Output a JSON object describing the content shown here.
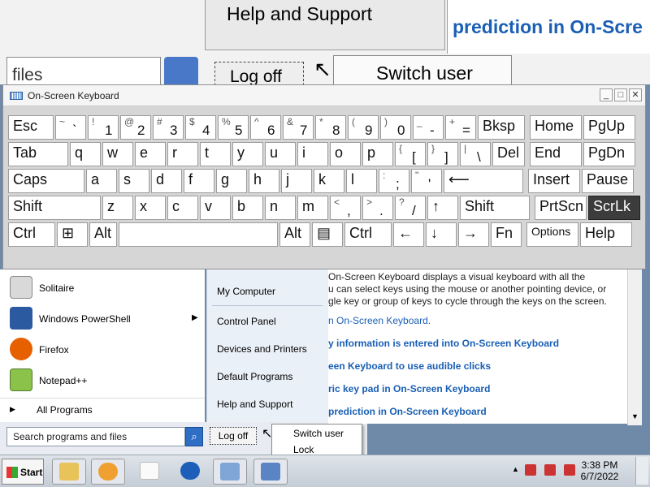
{
  "background": {
    "help_and_support": "Help and Support",
    "prediction_text": "prediction in On-Scre",
    "files_text": "files",
    "log_off": "Log off",
    "switch_user": "Switch user"
  },
  "osk": {
    "title": "On-Screen Keyboard",
    "controls": [
      "_",
      "□",
      "✕"
    ]
  },
  "keyboard": {
    "row1": [
      {
        "m": "Esc"
      },
      {
        "t": "~",
        "b": "`"
      },
      {
        "t": "!",
        "b": "1"
      },
      {
        "t": "@",
        "b": "2"
      },
      {
        "t": "#",
        "b": "3"
      },
      {
        "t": "$",
        "b": "4"
      },
      {
        "t": "%",
        "b": "5"
      },
      {
        "t": "^",
        "b": "6"
      },
      {
        "t": "&",
        "b": "7"
      },
      {
        "t": "*",
        "b": "8"
      },
      {
        "t": "(",
        "b": "9"
      },
      {
        "t": ")",
        "b": "0"
      },
      {
        "t": "_",
        "b": "-"
      },
      {
        "t": "+",
        "b": "="
      },
      {
        "m": "Bksp"
      },
      {
        "m": "Home"
      },
      {
        "m": "PgUp"
      }
    ],
    "row2": [
      {
        "m": "Tab"
      },
      {
        "m": "q"
      },
      {
        "m": "w"
      },
      {
        "m": "e"
      },
      {
        "m": "r"
      },
      {
        "m": "t"
      },
      {
        "m": "y"
      },
      {
        "m": "u"
      },
      {
        "m": "i"
      },
      {
        "m": "o"
      },
      {
        "m": "p"
      },
      {
        "t": "{",
        "b": "["
      },
      {
        "t": "}",
        "b": "]"
      },
      {
        "t": "|",
        "b": "\\"
      },
      {
        "m": "Del"
      },
      {
        "m": "End"
      },
      {
        "m": "PgDn"
      }
    ],
    "row3": [
      {
        "m": "Caps"
      },
      {
        "m": "a"
      },
      {
        "m": "s"
      },
      {
        "m": "d"
      },
      {
        "m": "f"
      },
      {
        "m": "g"
      },
      {
        "m": "h"
      },
      {
        "m": "j"
      },
      {
        "m": "k"
      },
      {
        "m": "l"
      },
      {
        "t": ":",
        "b": ";"
      },
      {
        "t": "\"",
        "b": "'"
      },
      {
        "m": "⟵"
      },
      {
        "m": "Insert"
      },
      {
        "m": "Pause"
      }
    ],
    "row4": [
      {
        "m": "Shift"
      },
      {
        "m": "z"
      },
      {
        "m": "x"
      },
      {
        "m": "c"
      },
      {
        "m": "v"
      },
      {
        "m": "b"
      },
      {
        "m": "n"
      },
      {
        "m": "m"
      },
      {
        "t": "<",
        "b": ","
      },
      {
        "t": ">",
        "b": "."
      },
      {
        "t": "?",
        "b": "/"
      },
      {
        "m": "↑"
      },
      {
        "m": "Shift"
      },
      {
        "m": "PrtScn"
      },
      {
        "m": "ScrLk"
      }
    ],
    "row5": [
      {
        "m": "Ctrl"
      },
      {
        "m": "⊞"
      },
      {
        "m": "Alt"
      },
      {
        "m": ""
      },
      {
        "m": "Alt"
      },
      {
        "m": "▤"
      },
      {
        "m": "Ctrl"
      },
      {
        "m": "←"
      },
      {
        "m": "↓"
      },
      {
        "m": "→"
      },
      {
        "m": "Fn"
      },
      {
        "m": "Options"
      },
      {
        "m": "Help"
      }
    ]
  },
  "start_menu": {
    "programs": [
      {
        "label": "Solitaire",
        "icon": "solitaire-icon",
        "color": "#d9d9d9"
      },
      {
        "label": "Windows PowerShell",
        "icon": "powershell-icon",
        "color": "#2c5aa0"
      },
      {
        "label": "Firefox",
        "icon": "firefox-icon",
        "color": "#e66000"
      },
      {
        "label": "Notepad++",
        "icon": "notepadpp-icon",
        "color": "#8bc34a"
      }
    ],
    "all_programs": "All Programs",
    "right": {
      "my_computer": "My Computer",
      "control_panel": "Control Panel",
      "devices_printers": "Devices and Printers",
      "default_programs": "Default Programs",
      "help_support": "Help and Support"
    },
    "search_placeholder": "Search programs and files",
    "log_off": "Log off",
    "popup": {
      "switch_user": "Switch user",
      "lock": "Lock"
    }
  },
  "help": {
    "line1": "On-Screen Keyboard displays a visual keyboard with all the",
    "line2": "u can select keys using the mouse or another pointing device, or",
    "line3": "gle key or group of keys to cycle through the keys on the screen.",
    "link1": "n On-Screen Keyboard.",
    "link2": "y information is entered into On-Screen Keyboard",
    "link3": "een Keyboard to use audible clicks",
    "link4": "ric key pad in On-Screen Keyboard",
    "link5": "prediction in On-Screen Keyboard"
  },
  "taskbar": {
    "start": "Start",
    "time": "3:38 PM",
    "date": "6/7/2022"
  }
}
